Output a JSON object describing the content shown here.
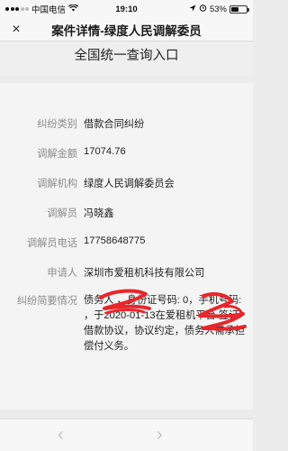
{
  "status_bar": {
    "carrier": "中国电信",
    "network": "4G",
    "time": "19:10",
    "battery_text": "53%",
    "battery_level": 0.53
  },
  "nav": {
    "close_glyph": "×",
    "title": "案件详情-绿度人民调解委员"
  },
  "page": {
    "heading": "全国统一查询入口"
  },
  "details": {
    "dispute_type": {
      "label": "纠纷类别",
      "value": "借款合同纠纷"
    },
    "amount": {
      "label": "调解金额",
      "value": "17074.76"
    },
    "agency": {
      "label": "调解机构",
      "value": "绿度人民调解委员会"
    },
    "mediator": {
      "label": "调解员",
      "value": "冯晓鑫"
    },
    "mediator_phone": {
      "label": "调解员电话",
      "value": "17758648775"
    },
    "applicant": {
      "label": "申请人",
      "value": "深圳市爱租机科技有限公司"
    },
    "summary": {
      "label": "纠纷简要情况",
      "value": "债务人 ，身份证号码: 0，手机号码: ，于2020-01-13在爱租机平台 签订借款协议，协议约定，债务人需承担偿付义务。"
    }
  },
  "bottom_nav": {
    "back_glyph": "‹",
    "forward_glyph": "›"
  },
  "colors": {
    "redaction": "#e8262b"
  }
}
